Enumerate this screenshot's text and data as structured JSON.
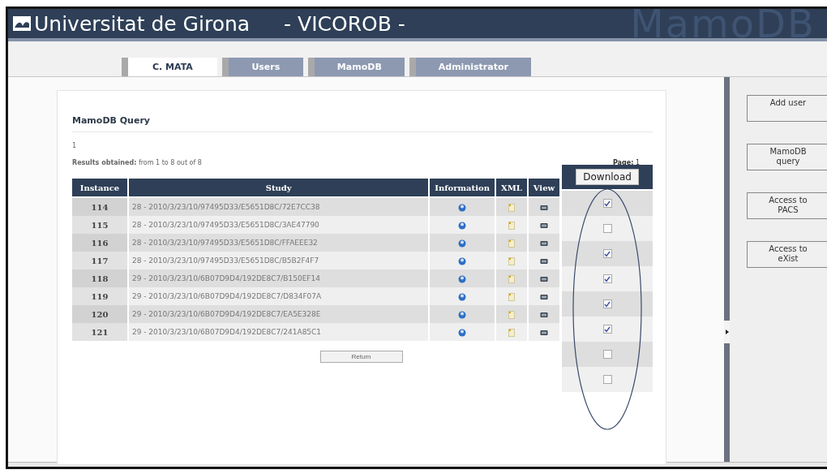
{
  "header": {
    "title": "Universitat de Girona",
    "subtitle": "- VICOROB -",
    "watermark": "MamoDB"
  },
  "tabs": [
    {
      "label": "C. MATA",
      "selected": true
    },
    {
      "label": "Users",
      "selected": false
    },
    {
      "label": "MamoDB",
      "selected": false
    },
    {
      "label": "Administrator",
      "selected": false
    }
  ],
  "query": {
    "title": "MamoDB Query",
    "line": "1",
    "results": "**Results obtained:** from 1 to 8 out of 8",
    "page": "**Page:** 1"
  },
  "table": {
    "columns": [
      "Instance",
      "Study",
      "Information",
      "XML",
      "View"
    ],
    "rows": [
      {
        "instance": "114",
        "study": "28 - 2010/3/23/10/97495D33/E5651D8C/72E7CC38"
      },
      {
        "instance": "115",
        "study": "28 - 2010/3/23/10/97495D33/E5651D8C/3AE47790"
      },
      {
        "instance": "116",
        "study": "28 - 2010/3/23/10/97495D33/E5651D8C/FFAEEE32"
      },
      {
        "instance": "117",
        "study": "28 - 2010/3/23/10/97495D33/E5651D8C/B5B2F4F7"
      },
      {
        "instance": "118",
        "study": "29 - 2010/3/23/10/6B07D9D4/192DE8C7/B150EF14"
      },
      {
        "instance": "119",
        "study": "29 - 2010/3/23/10/6B07D9D4/192DE8C7/D834F07A"
      },
      {
        "instance": "120",
        "study": "29 - 2010/3/23/10/6B07D9D4/192DE8C7/EA5E328E"
      },
      {
        "instance": "121",
        "study": "29 - 2010/3/23/10/6B07D9D4/192DE8C7/241A85C1"
      }
    ]
  },
  "return_button": "Return",
  "download": {
    "button": "Download",
    "checkboxes": [
      {
        "checked": true
      },
      {
        "checked": false
      },
      {
        "checked": true
      },
      {
        "checked": true
      },
      {
        "checked": true
      },
      {
        "checked": true
      },
      {
        "checked": false
      },
      {
        "checked": false
      }
    ]
  },
  "sidebar": {
    "buttons": [
      "Add user",
      "MamoDB query",
      "Access to PACS",
      "Access to eXist"
    ]
  }
}
